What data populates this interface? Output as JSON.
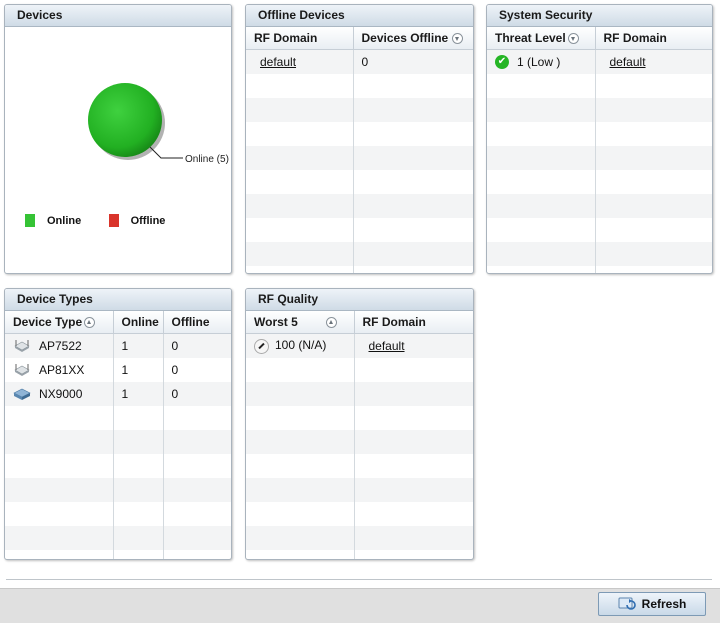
{
  "panels": {
    "devices": {
      "title": "Devices",
      "pie_label": "Online (5)",
      "legend": [
        {
          "label": "Online",
          "color": "#35c335"
        },
        {
          "label": "Offline",
          "color": "#d9342b"
        }
      ]
    },
    "offline_devices": {
      "title": "Offline Devices",
      "columns": [
        "RF Domain",
        "Devices Offline"
      ],
      "rows": [
        {
          "rf_domain": "default",
          "devices_offline": "0"
        }
      ]
    },
    "system_security": {
      "title": "System Security",
      "columns": [
        "Threat Level",
        "RF Domain"
      ],
      "rows": [
        {
          "threat_level": "1 (Low )",
          "rf_domain": "default",
          "icon": "check-circle-icon"
        }
      ]
    },
    "device_types": {
      "title": "Device Types",
      "columns": [
        "Device Type",
        "Online",
        "Offline"
      ],
      "rows": [
        {
          "device_type": "AP7522",
          "online": "1",
          "offline": "0",
          "icon": "access-point-icon"
        },
        {
          "device_type": "AP81XX",
          "online": "1",
          "offline": "0",
          "icon": "access-point-icon"
        },
        {
          "device_type": "NX9000",
          "online": "1",
          "offline": "0",
          "icon": "controller-icon"
        }
      ]
    },
    "rf_quality": {
      "title": "RF Quality",
      "columns": [
        "Worst 5",
        "RF Domain"
      ],
      "rows": [
        {
          "worst": "100 (N/A)",
          "rf_domain": "default",
          "icon": "gauge-icon"
        }
      ]
    }
  },
  "footer": {
    "refresh_label": "Refresh"
  },
  "chart_data": {
    "type": "pie",
    "categories": [
      "Online",
      "Offline"
    ],
    "values": [
      5,
      0
    ],
    "colors": [
      "#35c335",
      "#d9342b"
    ],
    "annotations": [
      "Online (5)"
    ],
    "legend_position": "bottom"
  }
}
